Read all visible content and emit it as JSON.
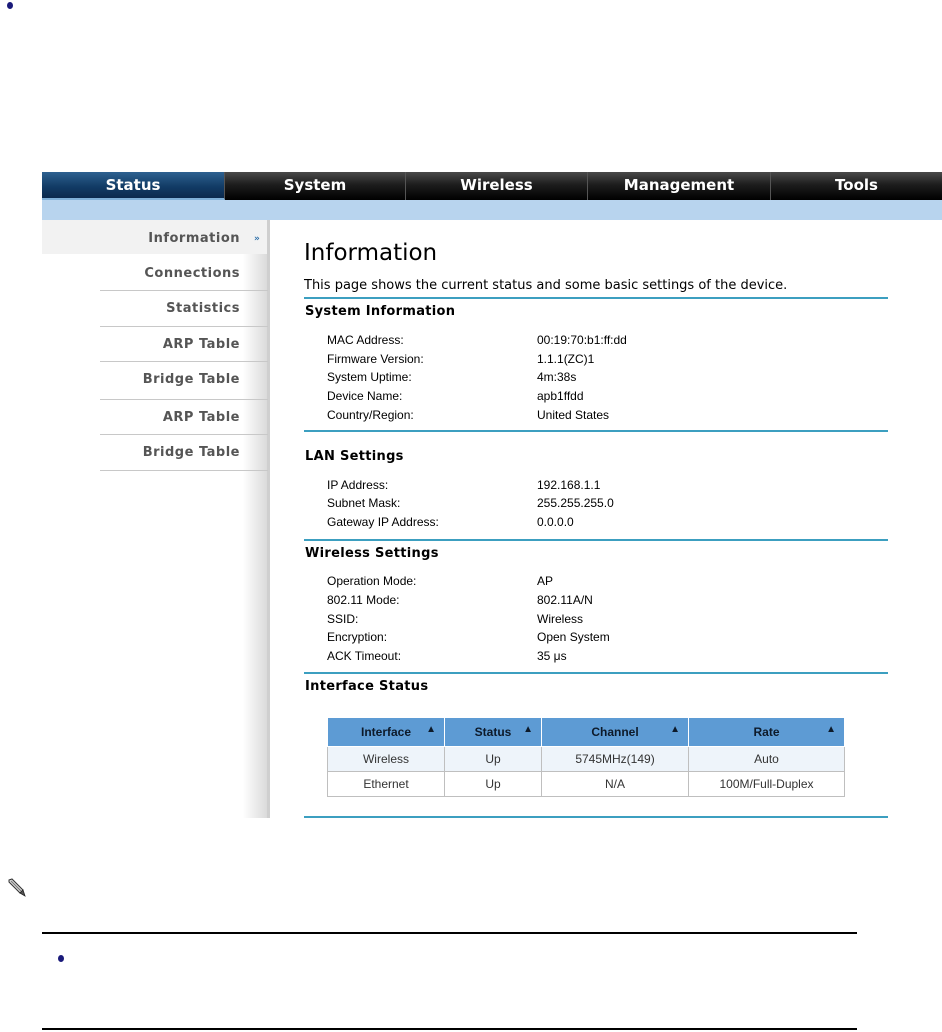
{
  "nav": {
    "tabs": [
      {
        "label": "Status",
        "active": true
      },
      {
        "label": "System",
        "active": false
      },
      {
        "label": "Wireless",
        "active": false
      },
      {
        "label": "Management",
        "active": false
      },
      {
        "label": "Tools",
        "active": false
      }
    ]
  },
  "sidebar": {
    "items": [
      {
        "label": "Information",
        "active": true
      },
      {
        "label": "Connections"
      },
      {
        "label": "Statistics"
      },
      {
        "label": "ARP Table"
      },
      {
        "label": "Bridge Table"
      },
      {
        "label": "ARP Table"
      },
      {
        "label": "Bridge Table"
      }
    ]
  },
  "page": {
    "title": "Information",
    "description": "This page shows the current status and some basic settings of the device."
  },
  "system_info": {
    "title": "System Information",
    "rows": [
      {
        "label": "MAC Address:",
        "value": "00:19:70:b1:ff:dd"
      },
      {
        "label": "Firmware Version:",
        "value": "1.1.1(ZC)1"
      },
      {
        "label": "System Uptime:",
        "value": "4m:38s"
      },
      {
        "label": "Device Name:",
        "value": "apb1ffdd"
      },
      {
        "label": "Country/Region:",
        "value": "United States"
      }
    ]
  },
  "lan_settings": {
    "title": "LAN Settings",
    "rows": [
      {
        "label": "IP Address:",
        "value": "192.168.1.1"
      },
      {
        "label": "Subnet Mask:",
        "value": "255.255.255.0"
      },
      {
        "label": "Gateway IP Address:",
        "value": "0.0.0.0"
      }
    ]
  },
  "wireless_settings": {
    "title": "Wireless Settings",
    "rows": [
      {
        "label": "Operation Mode:",
        "value": "AP"
      },
      {
        "label": "802.11 Mode:",
        "value": "802.11A/N"
      },
      {
        "label": "SSID:",
        "value": "Wireless"
      },
      {
        "label": "Encryption:",
        "value": "Open System"
      },
      {
        "label": "ACK Timeout:",
        "value": "35 μs"
      }
    ]
  },
  "interface_status": {
    "title": "Interface Status",
    "columns": [
      "Interface",
      "Status",
      "Channel",
      "Rate"
    ],
    "rows": [
      [
        "Wireless",
        "Up",
        "5745MHz(149)",
        "Auto"
      ],
      [
        "Ethernet",
        "Up",
        "N/A",
        "100M/Full-Duplex"
      ]
    ]
  },
  "icons": {
    "sort": "sort-icon",
    "active_arrow": "double-chevron-right-icon",
    "note": "pencil-icon",
    "bullet": "bullet-icon"
  },
  "colors": {
    "nav_active": "#123c66",
    "accent_rule": "#3c9fc0",
    "table_header": "#5d9bd4",
    "subbar": "#b8d4ee"
  }
}
